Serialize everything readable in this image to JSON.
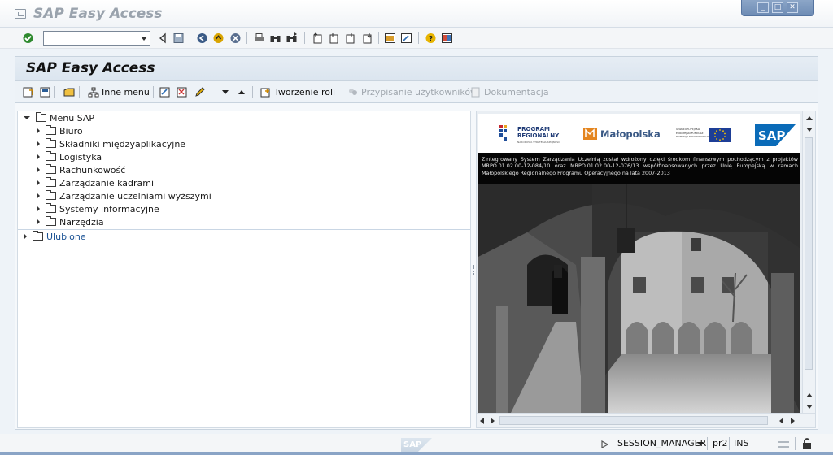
{
  "window": {
    "title": "SAP Easy Access",
    "controls": [
      "_",
      "□",
      "✕"
    ]
  },
  "toolbar": {
    "command_field_value": "",
    "icons": [
      "enter-icon",
      "command-dropdown-icon",
      "back-icon",
      "save-icon",
      "back-nav-icon",
      "exit-icon",
      "cancel-icon",
      "print-icon",
      "find-icon",
      "find-next-icon",
      "first-page-icon",
      "previous-page-icon",
      "next-page-icon",
      "last-page-icon",
      "create-session-icon",
      "shortcut-icon",
      "help-icon",
      "layout-icon"
    ]
  },
  "panel": {
    "title": "SAP Easy Access"
  },
  "appbar": {
    "inne_menu": "Inne menu",
    "tworzenie_roli": "Tworzenie roli",
    "przypisanie": "Przypisanie użytkowników",
    "dokumentacja": "Dokumentacja"
  },
  "tree": {
    "root": "Menu SAP",
    "items": [
      {
        "label": "Biuro"
      },
      {
        "label": "Składniki międzyaplikacyjne"
      },
      {
        "label": "Logistyka"
      },
      {
        "label": "Rachunkowość"
      },
      {
        "label": "Zarządzanie kadrami"
      },
      {
        "label": "Zarządzanie uczelniami wyższymi"
      },
      {
        "label": "Systemy informacyjne"
      },
      {
        "label": "Narzędzia"
      }
    ],
    "favorites": "Ulubione"
  },
  "banner": {
    "program_line1": "PROGRAM",
    "program_line2": "REGIONALNY",
    "program_line3": "NARODOWA STRATEGIA SPÓJNOŚCI",
    "malopolska": "Małopolska",
    "eu_line1": "UNIA EUROPEJSKA",
    "eu_line2": "EUROPEJSKI FUNDUSZ",
    "eu_line3": "ROZWOJU REGIONALNEGO",
    "sap": "SAP",
    "note": "Zintegrowany System Zarządzania Uczelnią został wdrożony dzięki środkom finansowym pochodzącym z projektów MRPO.01.02.00-12-084/10 oraz MRPO.01.02.00-12-076/13 współfinansowanych przez Unię Europejską w ramach Małopolskiego Regionalnego Programu Operacyjnego na lata 2007-2013"
  },
  "statusbar": {
    "sap_logo": "SAP",
    "session": "SESSION_MANAGER",
    "system": "pr2",
    "mode": "INS"
  },
  "colors": {
    "accent": "#1a5294",
    "panel_header": "#dbe5ef",
    "window_controls": "#6e8cb5"
  }
}
